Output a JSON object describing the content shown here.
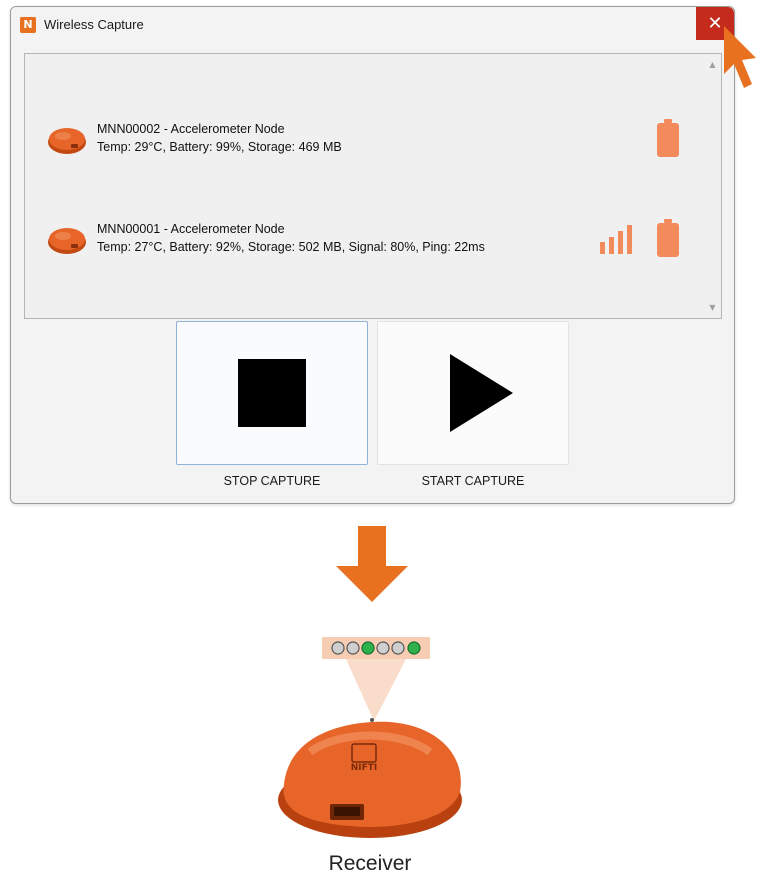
{
  "window": {
    "title": "Wireless Capture",
    "app_icon_glyph": "N",
    "close_glyph": "✕"
  },
  "devices": [
    {
      "name": "MNN00002 - Accelerometer Node",
      "info": "Temp: 29°C, Battery: 99%, Storage: 469 MB",
      "battery_pct": 99,
      "has_signal": false
    },
    {
      "name": "MNN00001 - Accelerometer Node",
      "info": "Temp: 27°C, Battery: 92%, Storage: 502 MB, Signal: 80%, Ping: 22ms",
      "battery_pct": 92,
      "signal_pct": 80,
      "has_signal": true
    }
  ],
  "buttons": {
    "stop_label": "STOP CAPTURE",
    "start_label": "START CAPTURE"
  },
  "receiver": {
    "label": "Receiver",
    "leds": [
      "off",
      "off",
      "on",
      "off",
      "off",
      "on"
    ]
  },
  "colors": {
    "accent": "#e8711f",
    "icon_orange": "#f28a5b",
    "close_red": "#c42b1c",
    "led_on": "#2db14a",
    "led_off": "#cfcfcf"
  },
  "icons": {
    "app": "nifti-logo-icon",
    "close": "close-icon",
    "cursor": "mouse-cursor-icon",
    "stop": "stop-square-icon",
    "start": "play-triangle-icon",
    "arrow": "down-arrow-icon",
    "battery": "battery-icon",
    "signal": "signal-bars-icon"
  }
}
